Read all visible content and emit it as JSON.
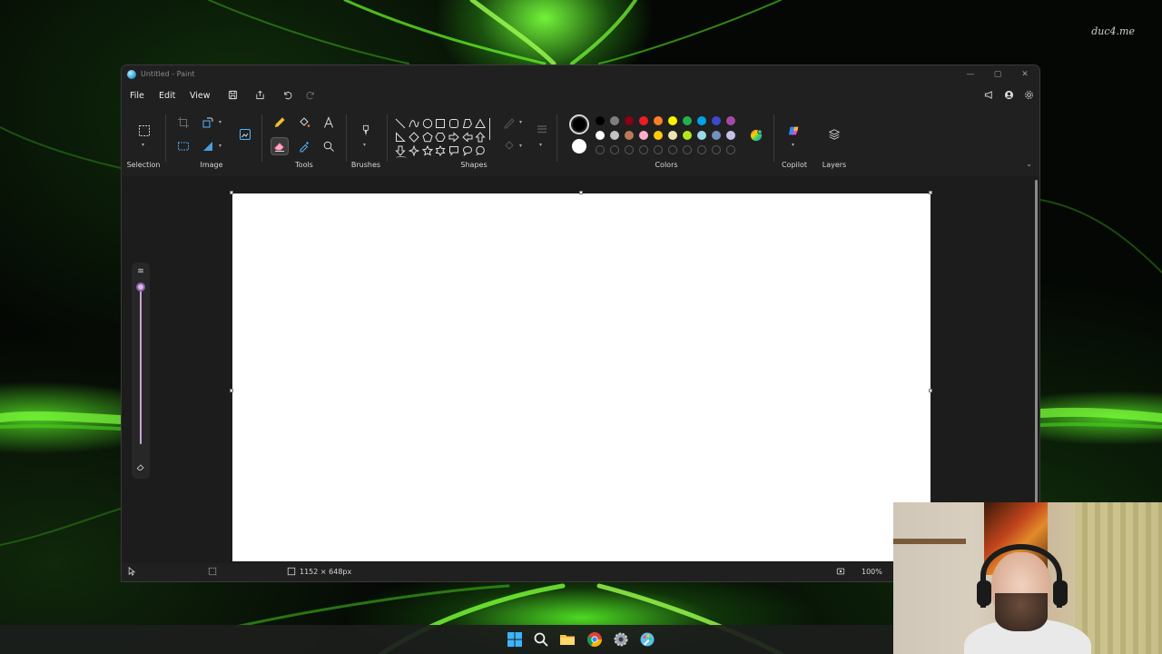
{
  "desktop": {
    "watermark": "duc4.me"
  },
  "window": {
    "title": "Untitled - Paint",
    "controls": {
      "minimize": "—",
      "maximize": "▢",
      "close": "✕"
    }
  },
  "menubar": {
    "file": "File",
    "edit": "Edit",
    "view": "View",
    "icons": [
      "save-icon",
      "share-icon",
      "undo-icon",
      "redo-icon"
    ],
    "right_icons": [
      "announcement-icon",
      "account-icon",
      "settings-icon"
    ]
  },
  "ribbon": {
    "selection": {
      "label": "Selection"
    },
    "image": {
      "label": "Image"
    },
    "tools": {
      "label": "Tools",
      "active": "eraser"
    },
    "brushes": {
      "label": "Brushes"
    },
    "shapes": {
      "label": "Shapes"
    },
    "colors": {
      "label": "Colors",
      "color1": "#000000",
      "color2": "#ffffff",
      "row1": [
        "#000000",
        "#7f7f7f",
        "#880015",
        "#ed1c24",
        "#ff7f27",
        "#fff200",
        "#22b14c",
        "#00a2e8",
        "#3f48cc",
        "#a349a4"
      ],
      "row2": [
        "#ffffff",
        "#c3c3c3",
        "#b97a57",
        "#ffaec9",
        "#ffc90e",
        "#efe4b0",
        "#b5e61d",
        "#99d9ea",
        "#7092be",
        "#c8bfe7"
      ],
      "empty_slots": 10
    },
    "copilot": {
      "label": "Copilot"
    },
    "layers": {
      "label": "Layers"
    }
  },
  "statusbar": {
    "canvas_size": "1152 × 648px",
    "zoom": "100%"
  },
  "taskbar": {
    "icons": [
      "windows-start-icon",
      "search-icon",
      "file-explorer-icon",
      "chrome-icon",
      "settings-icon",
      "paint-icon"
    ]
  }
}
